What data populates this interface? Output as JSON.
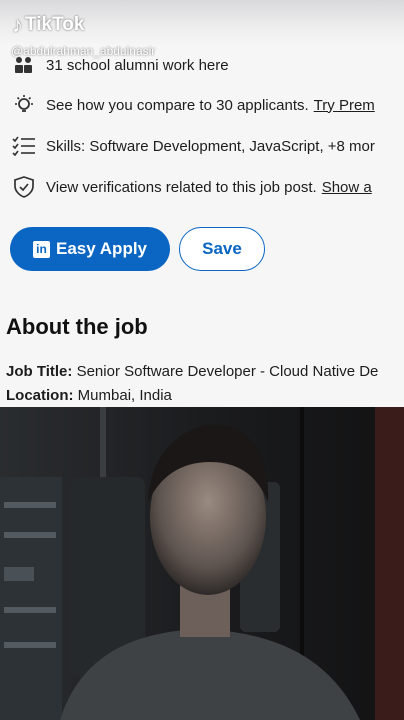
{
  "watermark": {
    "brand": "TikTok",
    "handle": "@abdulrahman_abdulnasir"
  },
  "insights": [
    {
      "icon": "people-icon",
      "text": "31 school alumni work here",
      "link": ""
    },
    {
      "icon": "lightbulb-icon",
      "text": "See how you compare to 30 applicants.",
      "link": "Try Prem"
    },
    {
      "icon": "checklist-icon",
      "text": "Skills: Software Development, JavaScript, +8 mor",
      "link": ""
    },
    {
      "icon": "shield-check-icon",
      "text": "View verifications related to this job post.",
      "link": "Show a"
    }
  ],
  "actions": {
    "easy_apply": "Easy Apply",
    "easy_apply_logo": "in",
    "save": "Save"
  },
  "about": {
    "heading": "About the job",
    "job_title_label": "Job Title:",
    "job_title_value": "Senior Software Developer - Cloud Native De",
    "location_label": "Location:",
    "location_value": "Mumbai, India"
  },
  "colors": {
    "linkedin_blue": "#0a66c2",
    "panel_bg": "#f6f6f7"
  }
}
